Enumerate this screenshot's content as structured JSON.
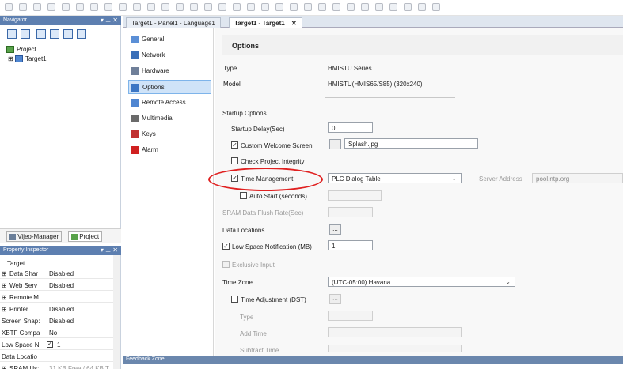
{
  "navigator": {
    "title": "Navigator",
    "controls": "▾ ⊥ ✕",
    "tree": [
      {
        "label": "Project",
        "expander": ""
      },
      {
        "label": "Target1",
        "expander": "⊞"
      }
    ],
    "tabs": [
      "Vijeo-Manager",
      "Project"
    ],
    "active_tab": "Project"
  },
  "property_inspector": {
    "title": "Property Inspector",
    "controls": "▾ ⊥ ✕",
    "header": "Target",
    "rows": [
      {
        "name": "Data Shar",
        "value": "Disabled",
        "expander": "⊞"
      },
      {
        "name": "Web Serv",
        "value": "Disabled",
        "expander": "⊞"
      },
      {
        "name": "Remote M",
        "value": "",
        "expander": "⊞"
      },
      {
        "name": "Printer",
        "value": "Disabled",
        "expander": "⊞"
      },
      {
        "name": "Screen Snap:",
        "value": "Disabled",
        "expander": ""
      },
      {
        "name": "XBTF Compa",
        "value": "No",
        "expander": ""
      },
      {
        "name": "Low Space N",
        "value": "1",
        "expander": "",
        "checkbox": true
      },
      {
        "name": "Data Locatio",
        "value": "",
        "expander": ""
      },
      {
        "name": "SRAM Us:",
        "value": "31 KB Free / 64 KB T",
        "expander": "⊞"
      }
    ]
  },
  "document_tabs": [
    {
      "label": "Target1 - Panel1 - Language1",
      "active": false
    },
    {
      "label": "Target1 - Target1",
      "active": true,
      "close": "✕"
    }
  ],
  "categories": [
    {
      "label": "General",
      "icon": "general-icon"
    },
    {
      "label": "Network",
      "icon": "network-icon"
    },
    {
      "label": "Hardware",
      "icon": "hardware-icon"
    },
    {
      "label": "Options",
      "icon": "options-icon",
      "selected": true
    },
    {
      "label": "Remote Access",
      "icon": "remote-access-icon"
    },
    {
      "label": "Multimedia",
      "icon": "multimedia-icon"
    },
    {
      "label": "Keys",
      "icon": "keys-icon"
    },
    {
      "label": "Alarm",
      "icon": "alarm-icon"
    }
  ],
  "options": {
    "heading": "Options",
    "type_label": "Type",
    "type_value": "HMISTU Series",
    "model_label": "Model",
    "model_value": "HMISTU(HMIS65/S85) (320x240)",
    "startup_options": "Startup Options",
    "startup_delay_label": "Startup Delay(Sec)",
    "startup_delay_value": "0",
    "custom_welcome_label": "Custom Welcome Screen",
    "custom_welcome_checked": true,
    "browse": "...",
    "welcome_file": "Splash.jpg",
    "check_integrity_label": "Check Project Integrity",
    "check_integrity_checked": false,
    "time_mgmt_label": "Time Management",
    "time_mgmt_checked": true,
    "time_mgmt_select": "PLC Dialog Table",
    "server_address_label": "Server Address",
    "server_address_value": "pool.ntp.org",
    "auto_start_label": "Auto Start (seconds)",
    "auto_start_checked": false,
    "sram_flush_label": "SRAM Data Flush Rate(Sec)",
    "data_locations_label": "Data Locations",
    "low_space_label": "Low Space Notification (MB)",
    "low_space_checked": true,
    "low_space_value": "1",
    "exclusive_input_label": "Exclusive Input",
    "time_zone_label": "Time Zone",
    "time_zone_value": "(UTC-05:00) Havana",
    "time_adjust_label": "Time Adjustment (DST)",
    "time_adjust_checked": false,
    "dst_type_label": "Type",
    "dst_add_time_label": "Add Time",
    "dst_subtract_label": "Subtract Time"
  },
  "feedback_zone": {
    "title": "Feedback Zone"
  },
  "colors": {
    "panel_title": "#5d7fb0",
    "selection": "#cfe3f8",
    "highlight": "#e02020"
  }
}
